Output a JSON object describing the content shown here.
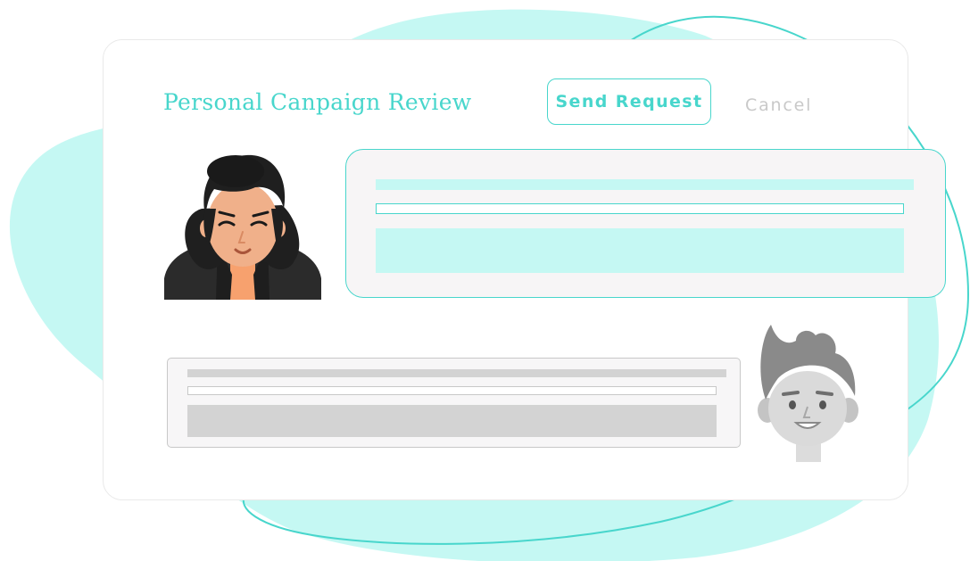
{
  "header": {
    "title": "Personal Canpaign Review",
    "send_label": "Send Request",
    "cancel_label": "Cancel"
  },
  "colors": {
    "accent": "#48d6cc",
    "accent_light": "#c5f8f3",
    "muted": "#c9c9c9",
    "neutral_fill": "#d3d3d3"
  },
  "icons": {
    "sender_avatar": "woman-avatar-icon",
    "recipient_avatar": "man-avatar-icon"
  }
}
